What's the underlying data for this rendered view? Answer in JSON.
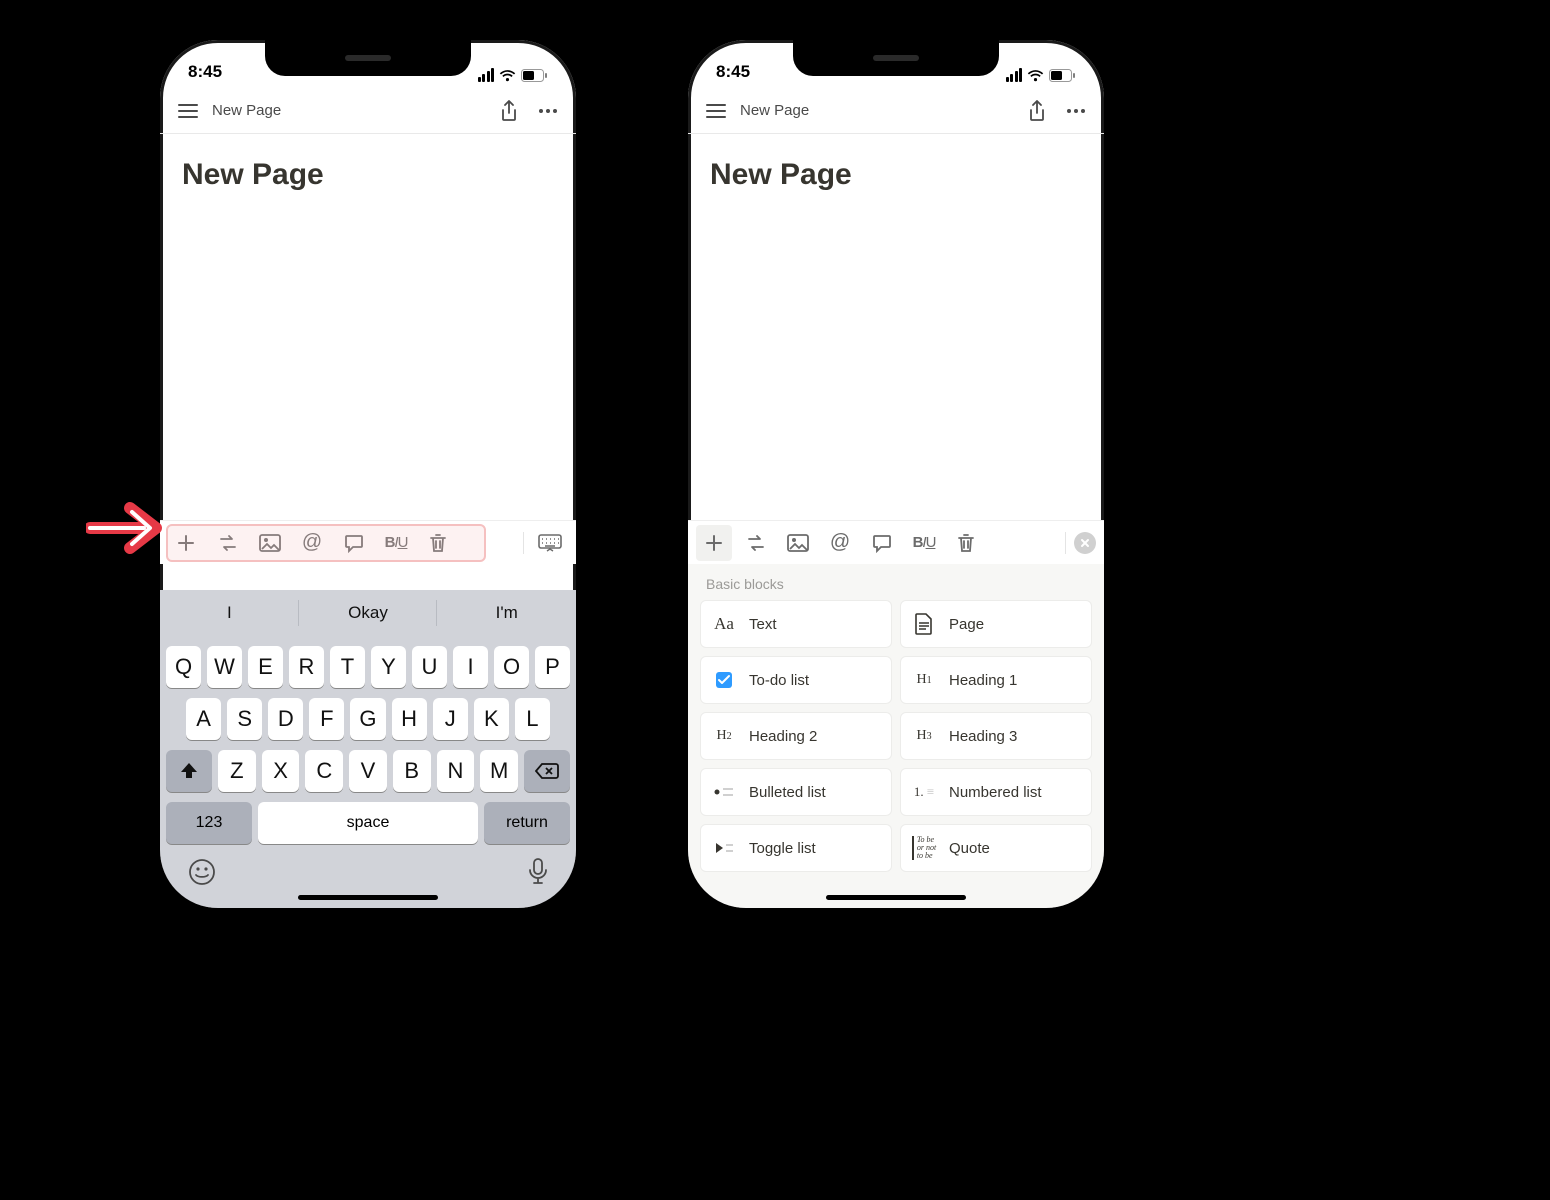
{
  "status": {
    "time": "8:45"
  },
  "nav": {
    "title": "New Page"
  },
  "page": {
    "title": "New Page"
  },
  "keyboard": {
    "suggestions": [
      "I",
      "Okay",
      "I'm"
    ],
    "row1": [
      "Q",
      "W",
      "E",
      "R",
      "T",
      "Y",
      "U",
      "I",
      "O",
      "P"
    ],
    "row2": [
      "A",
      "S",
      "D",
      "F",
      "G",
      "H",
      "J",
      "K",
      "L"
    ],
    "row3": [
      "Z",
      "X",
      "C",
      "V",
      "B",
      "N",
      "M"
    ],
    "key_123": "123",
    "key_space": "space",
    "key_return": "return"
  },
  "block_menu": {
    "header": "Basic blocks",
    "items": [
      {
        "label": "Text",
        "icon": "Aa"
      },
      {
        "label": "Page",
        "icon": "page"
      },
      {
        "label": "To-do list",
        "icon": "todo"
      },
      {
        "label": "Heading 1",
        "icon": "H1"
      },
      {
        "label": "Heading 2",
        "icon": "H2"
      },
      {
        "label": "Heading 3",
        "icon": "H3"
      },
      {
        "label": "Bulleted list",
        "icon": "bullet"
      },
      {
        "label": "Numbered list",
        "icon": "number"
      },
      {
        "label": "Toggle list",
        "icon": "toggle"
      },
      {
        "label": "Quote",
        "icon": "quote"
      }
    ]
  }
}
